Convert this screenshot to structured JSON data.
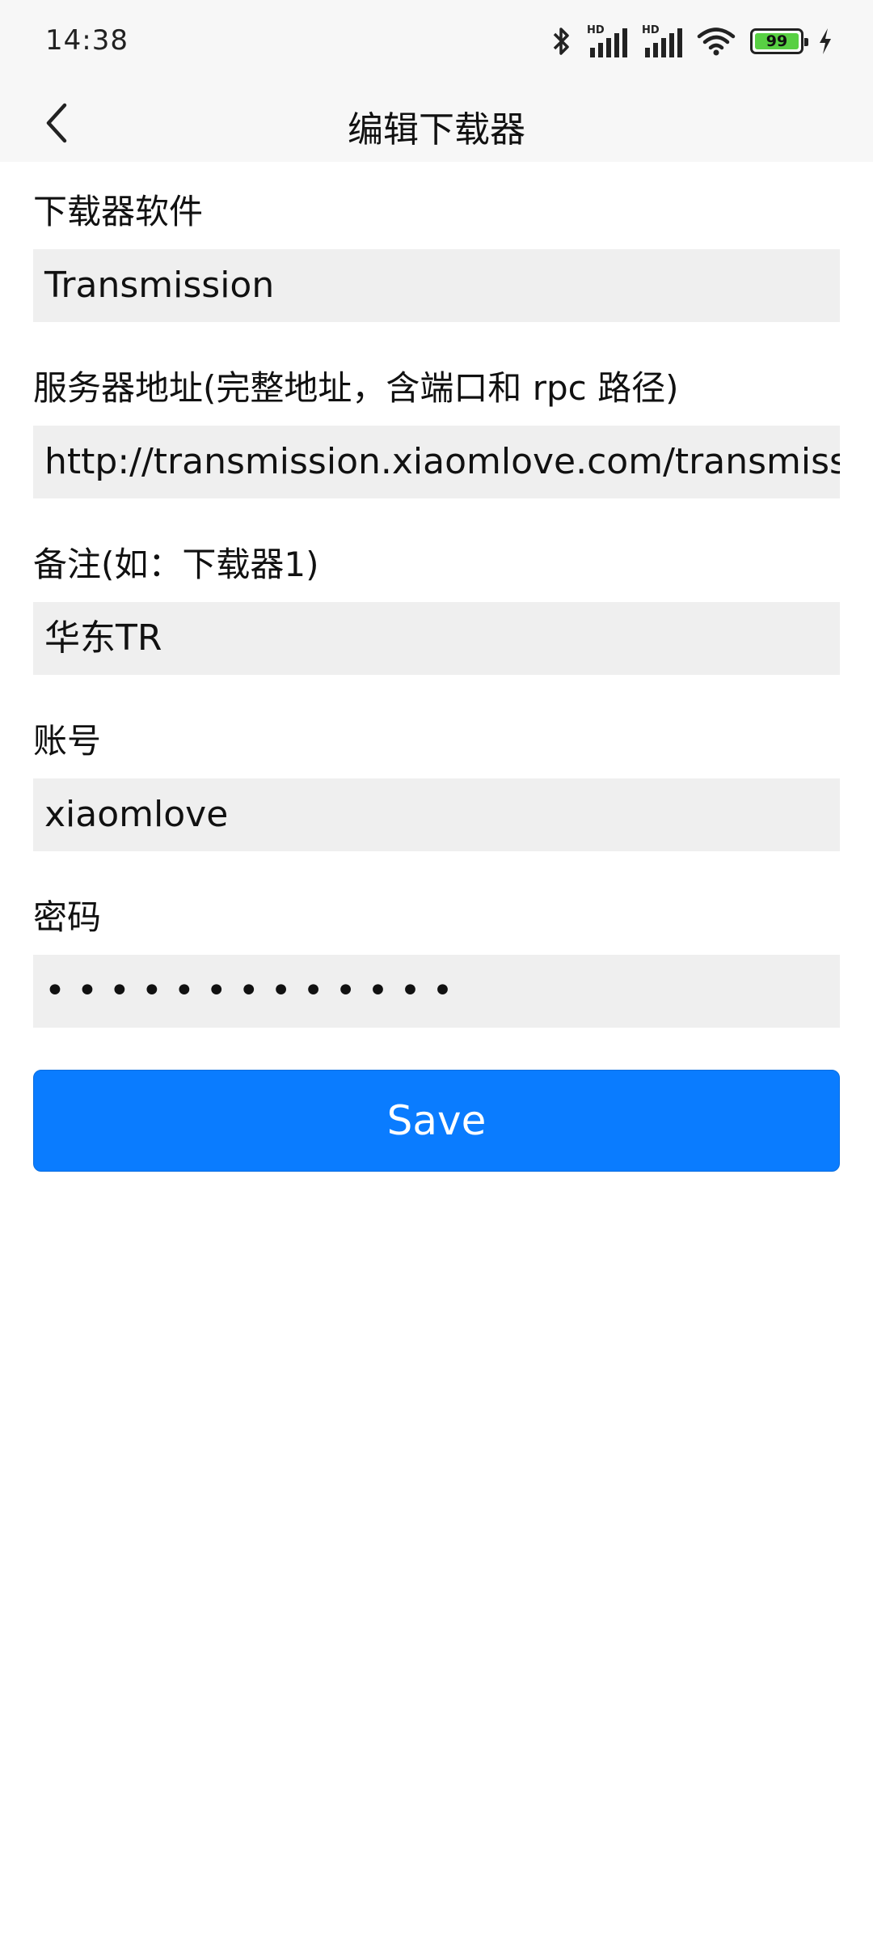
{
  "status_bar": {
    "time": "14:38",
    "icons": [
      "bluetooth-icon",
      "signal-hd-icon",
      "signal-hd-icon",
      "wifi-icon",
      "battery-icon",
      "charging-icon"
    ],
    "battery_level": "99",
    "network_badge": "HD"
  },
  "header": {
    "title": "编辑下载器",
    "back_icon": "chevron-left-icon"
  },
  "form": {
    "software": {
      "label": "下载器软件",
      "value": "Transmission"
    },
    "server": {
      "label": "服务器地址(完整地址，含端口和 rpc 路径)",
      "value": "http://transmission.xiaomlove.com/transmission/rpc"
    },
    "note": {
      "label": "备注(如：下载器1)",
      "value": "华东TR"
    },
    "account": {
      "label": "账号",
      "value": "xiaomlove"
    },
    "password": {
      "label": "密码",
      "masked": "•••••••••••••"
    },
    "save_label": "Save"
  },
  "colors": {
    "accent": "#0a7cff",
    "input_bg": "#efefef",
    "bar_bg": "#f7f7f7"
  }
}
